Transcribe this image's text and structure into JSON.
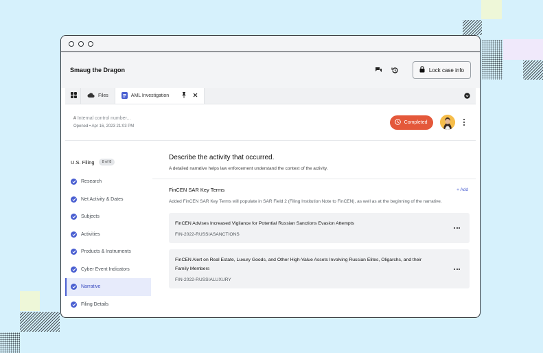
{
  "app": {
    "title": "Smaug the Dragon",
    "lock_label": "Lock case info"
  },
  "tabs": [
    {
      "label": "Files"
    },
    {
      "label": "AML Investigation"
    }
  ],
  "case": {
    "control_number_placeholder": "Internal control number...",
    "opened_prefix": "Opened",
    "opened_date": "Apr 16, 2023 21:03 PM",
    "status": "Completed"
  },
  "sidebar": {
    "title": "U.S. Filing",
    "progress": "8 of 8",
    "items": [
      {
        "label": "Research"
      },
      {
        "label": "Net Activity & Dates"
      },
      {
        "label": "Subjects"
      },
      {
        "label": "Activities"
      },
      {
        "label": "Products & Instruments"
      },
      {
        "label": "Cyber Event Indicators"
      },
      {
        "label": "Narrative"
      },
      {
        "label": "Filing Details"
      }
    ]
  },
  "main": {
    "title": "Describe the activity that occurred.",
    "subtitle": "A detailed narrative helps law enforcement understand the context of the activity.",
    "section_title": "FinCEN SAR Key Terms",
    "add_label": "Add",
    "section_desc": "Added FinCEN SAR Key Terms will populate in SAR Field 2 (Filing Institution Note to FinCEN), as well as at the beginning of the narrative.",
    "cards": [
      {
        "title": "FinCEN Advises Increased Vigilance for Potential Russian Sanctions Evasion Attempts",
        "code": "FIN-2022-RUSSIASANCTIONS"
      },
      {
        "title": "FinCEN Alert on Real Estate, Luxury Goods, and Other High-Value Assets Involving Russian Elites, Oligarchs, and their Family Members",
        "code": "FIN-2022-RUSSIALUXURY"
      }
    ]
  },
  "colors": {
    "accent": "#4a5fd1",
    "status": "#e4583a",
    "background": "#d6f1fc"
  }
}
